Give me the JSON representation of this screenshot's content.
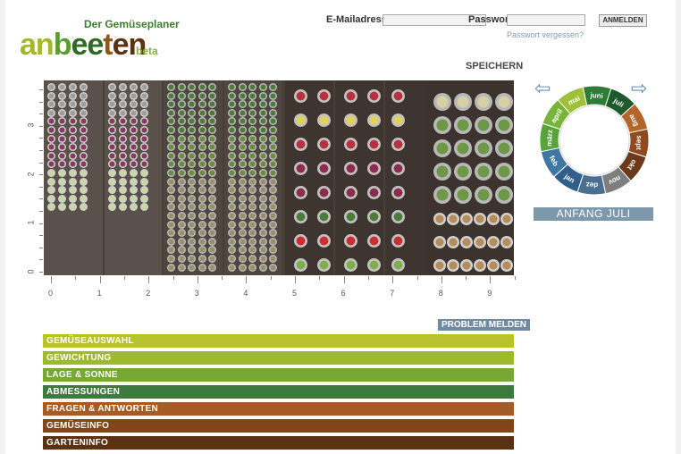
{
  "header": {
    "tagline": "Der Gemüseplaner",
    "logo_parts": [
      "an",
      "b",
      "ee",
      "t",
      "en"
    ],
    "beta": "beta"
  },
  "login": {
    "email_label": "E-Mailadresse",
    "password_label": "Passwort",
    "submit_label": "ANMELDEN",
    "forgot_label": "Passwort vergessen?"
  },
  "toolbar": {
    "save_label": "SPEICHERN"
  },
  "grid": {
    "x_labels": [
      "0",
      "1",
      "2",
      "3",
      "4",
      "5",
      "6",
      "7",
      "8",
      "9"
    ],
    "y_labels": [
      "0",
      "1",
      "2",
      "3"
    ]
  },
  "season": {
    "current_label": "ANFANG JULI",
    "months": [
      "jan",
      "feb",
      "märz",
      "april",
      "mai",
      "juni",
      "juli",
      "aug",
      "sept",
      "okt",
      "nov",
      "dez"
    ],
    "month_colors": [
      "#315f8c",
      "#3f77a3",
      "#58a33a",
      "#79b43a",
      "#a0c03a",
      "#2f7a34",
      "#1e5a2c",
      "#b4652a",
      "#8f4a1f",
      "#6a3a1a",
      "#7e7e7e",
      "#4a6f91"
    ]
  },
  "panels": {
    "report_label": "PROBLEM MELDEN",
    "items": [
      {
        "label": "GEMÜSEAUSWAHL",
        "color": "#b8c22b"
      },
      {
        "label": "GEWICHTUNG",
        "color": "#9dba2c"
      },
      {
        "label": "LAGE & SONNE",
        "color": "#77a835"
      },
      {
        "label": "ABMESSUNGEN",
        "color": "#3e7a3c"
      },
      {
        "label": "FRAGEN & ANTWORTEN",
        "color": "#a35d24"
      },
      {
        "label": "GEMÜSEINFO",
        "color": "#804619"
      },
      {
        "label": "GARTENINFO",
        "color": "#5a3212"
      }
    ]
  }
}
